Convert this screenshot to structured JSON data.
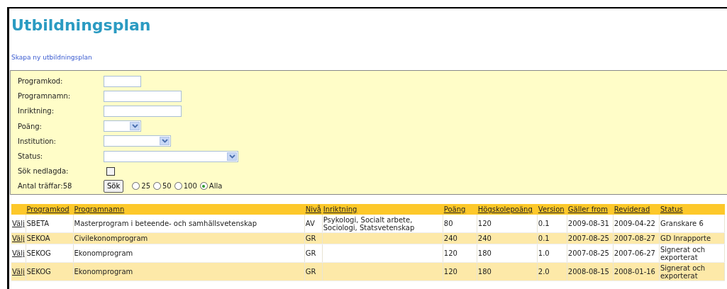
{
  "title": "Utbildningsplan",
  "create_link": "Skapa ny utbildningsplan",
  "filters": [
    {
      "label": "Programkod:",
      "kind": "text"
    },
    {
      "label": "Programnamn:",
      "kind": "text"
    },
    {
      "label": "Inriktning:",
      "kind": "text"
    },
    {
      "label": "Poäng:",
      "kind": "select"
    },
    {
      "label": "Institution:",
      "kind": "select"
    },
    {
      "label": "Status:",
      "kind": "select"
    },
    {
      "label": "Sök nedlagda:",
      "kind": "checkbox",
      "checked": false
    }
  ],
  "hits_label": "Antal träffar:58",
  "search_button": "Sök",
  "page_sizes": [
    {
      "label": "25",
      "selected": false
    },
    {
      "label": "50",
      "selected": false
    },
    {
      "label": "100",
      "selected": false
    },
    {
      "label": "Alla",
      "selected": true
    }
  ],
  "table": {
    "columns": [
      "Programkod",
      "Programnamn",
      "Nivå",
      "Inriktning",
      "Poäng",
      "Högskolepoäng",
      "Version",
      "Gäller from",
      "Reviderad",
      "Status"
    ],
    "rows": [
      {
        "action": "Välj",
        "cells": [
          "SBETA",
          "Masterprogram i beteende- och samhällsvetenskap",
          "AV",
          "Psykologi, Socialt arbete, Sociologi, Statsvetenskap",
          "80",
          "120",
          "0.1",
          "2009-08-31",
          "2009-04-22",
          "Granskare 6"
        ]
      },
      {
        "action": "Välj",
        "cells": [
          "SEKOA",
          "Civilekonomprogram",
          "GR",
          "",
          "240",
          "240",
          "0.1",
          "2007-08-25",
          "2007-08-27",
          "GD Inrapporte"
        ]
      },
      {
        "action": "Välj",
        "cells": [
          "SEKOG",
          "Ekonomprogram",
          "GR",
          "",
          "120",
          "180",
          "1.0",
          "2007-08-25",
          "2007-06-27",
          "Signerat och exporterat"
        ]
      },
      {
        "action": "Välj",
        "cells": [
          "SEKOG",
          "Ekonomprogram",
          "GR",
          "",
          "120",
          "180",
          "2.0",
          "2008-08-15",
          "2008-01-16",
          "Signerat och exporterat"
        ]
      }
    ]
  }
}
